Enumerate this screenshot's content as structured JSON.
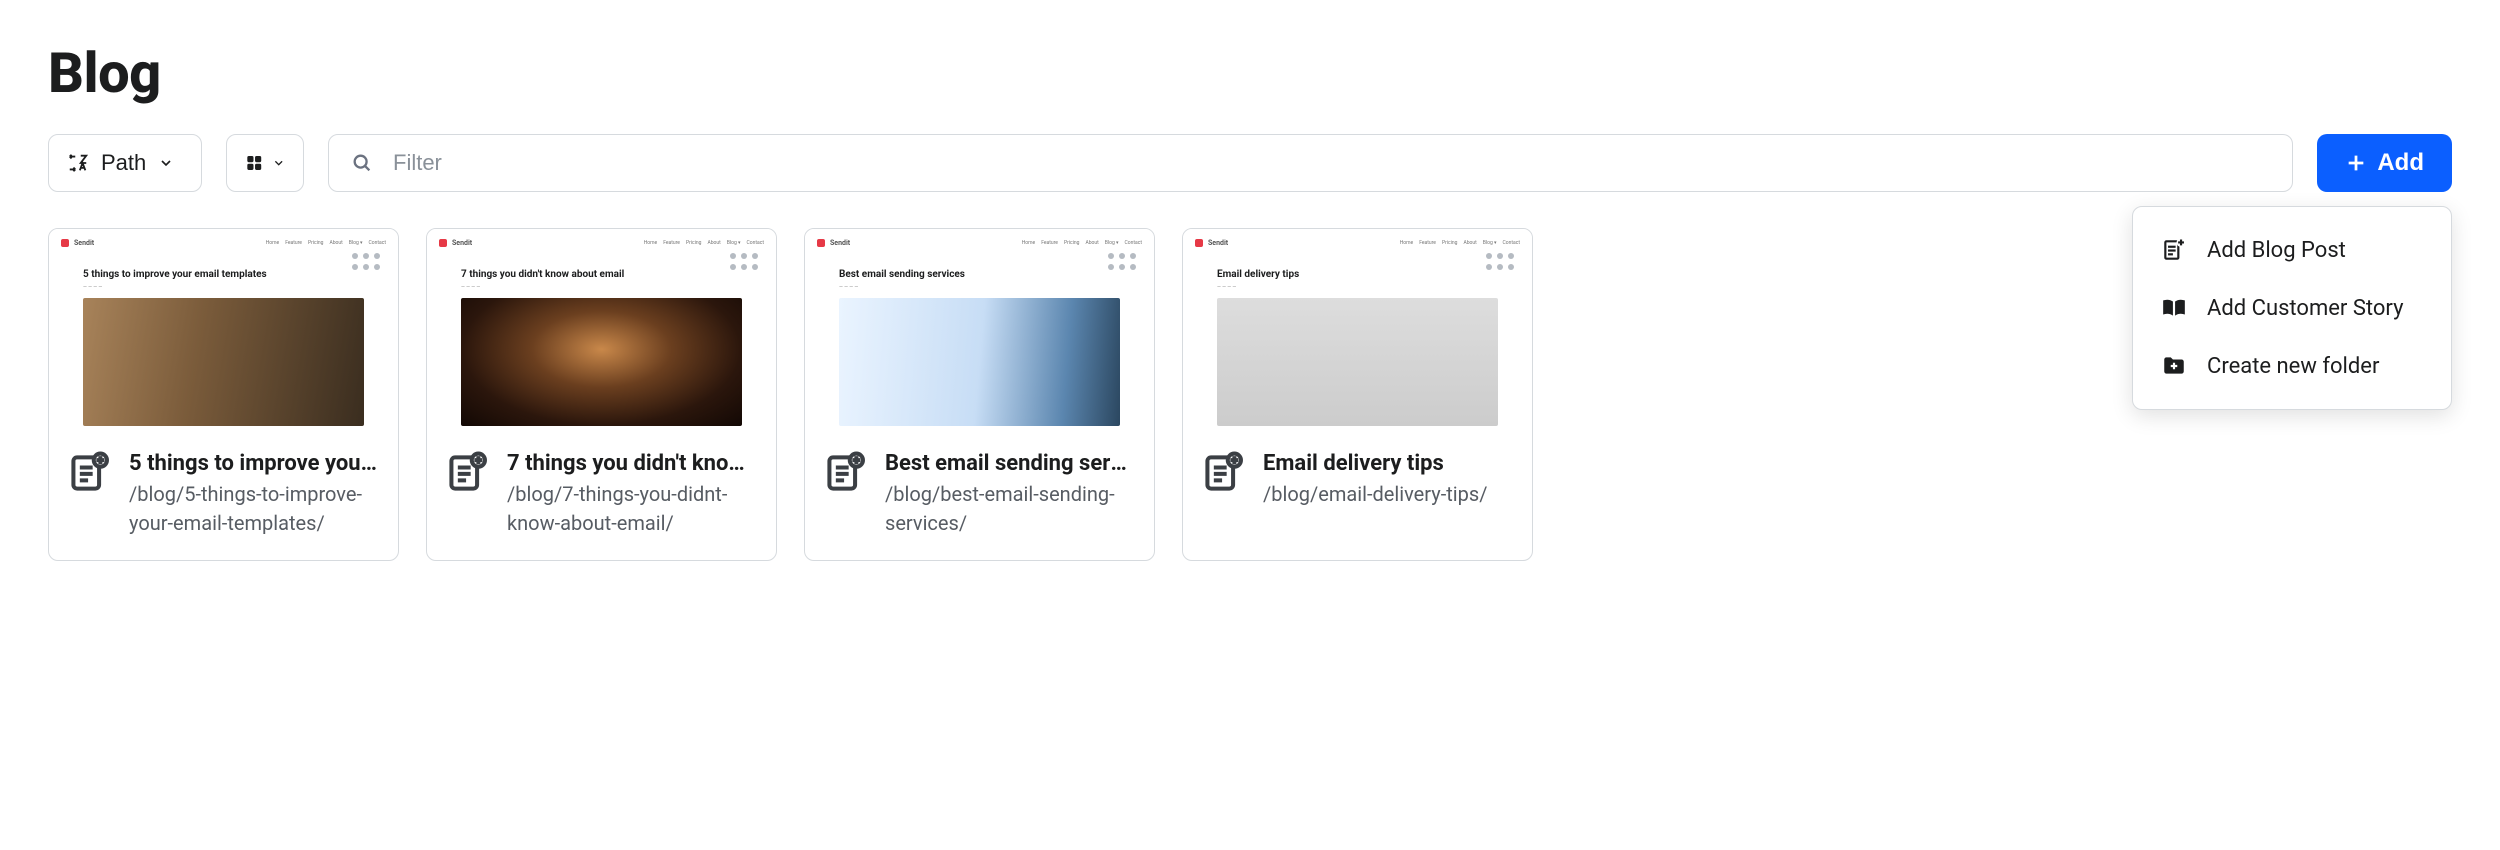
{
  "page_title": "Blog",
  "toolbar": {
    "sort_label": "Path",
    "filter_placeholder": "Filter",
    "add_label": "Add"
  },
  "add_menu": {
    "items": [
      {
        "label": "Add Blog Post",
        "icon": "page-add-icon"
      },
      {
        "label": "Add Customer Story",
        "icon": "book-open-icon"
      },
      {
        "label": "Create new folder",
        "icon": "folder-add-icon"
      }
    ]
  },
  "cards": [
    {
      "mini_title": "5 things to improve your email templates",
      "title": "5 things to improve your ...",
      "path": "/blog/5-things-to-improve-your-email-templates/"
    },
    {
      "mini_title": "7 things you didn't know about email",
      "title": "7 things you didn't know ...",
      "path": "/blog/7-things-you-didnt-know-about-email/"
    },
    {
      "mini_title": "Best email sending services",
      "title": "Best email sending servi...",
      "path": "/blog/best-email-sending-services/"
    },
    {
      "mini_title": "Email delivery tips",
      "title": "Email delivery tips",
      "path": "/blog/email-delivery-tips/"
    }
  ],
  "mini_nav_links": [
    "Home",
    "Feature",
    "Pricing",
    "About",
    "Blog ▾",
    "Contact"
  ],
  "mini_brand": "Sendit"
}
